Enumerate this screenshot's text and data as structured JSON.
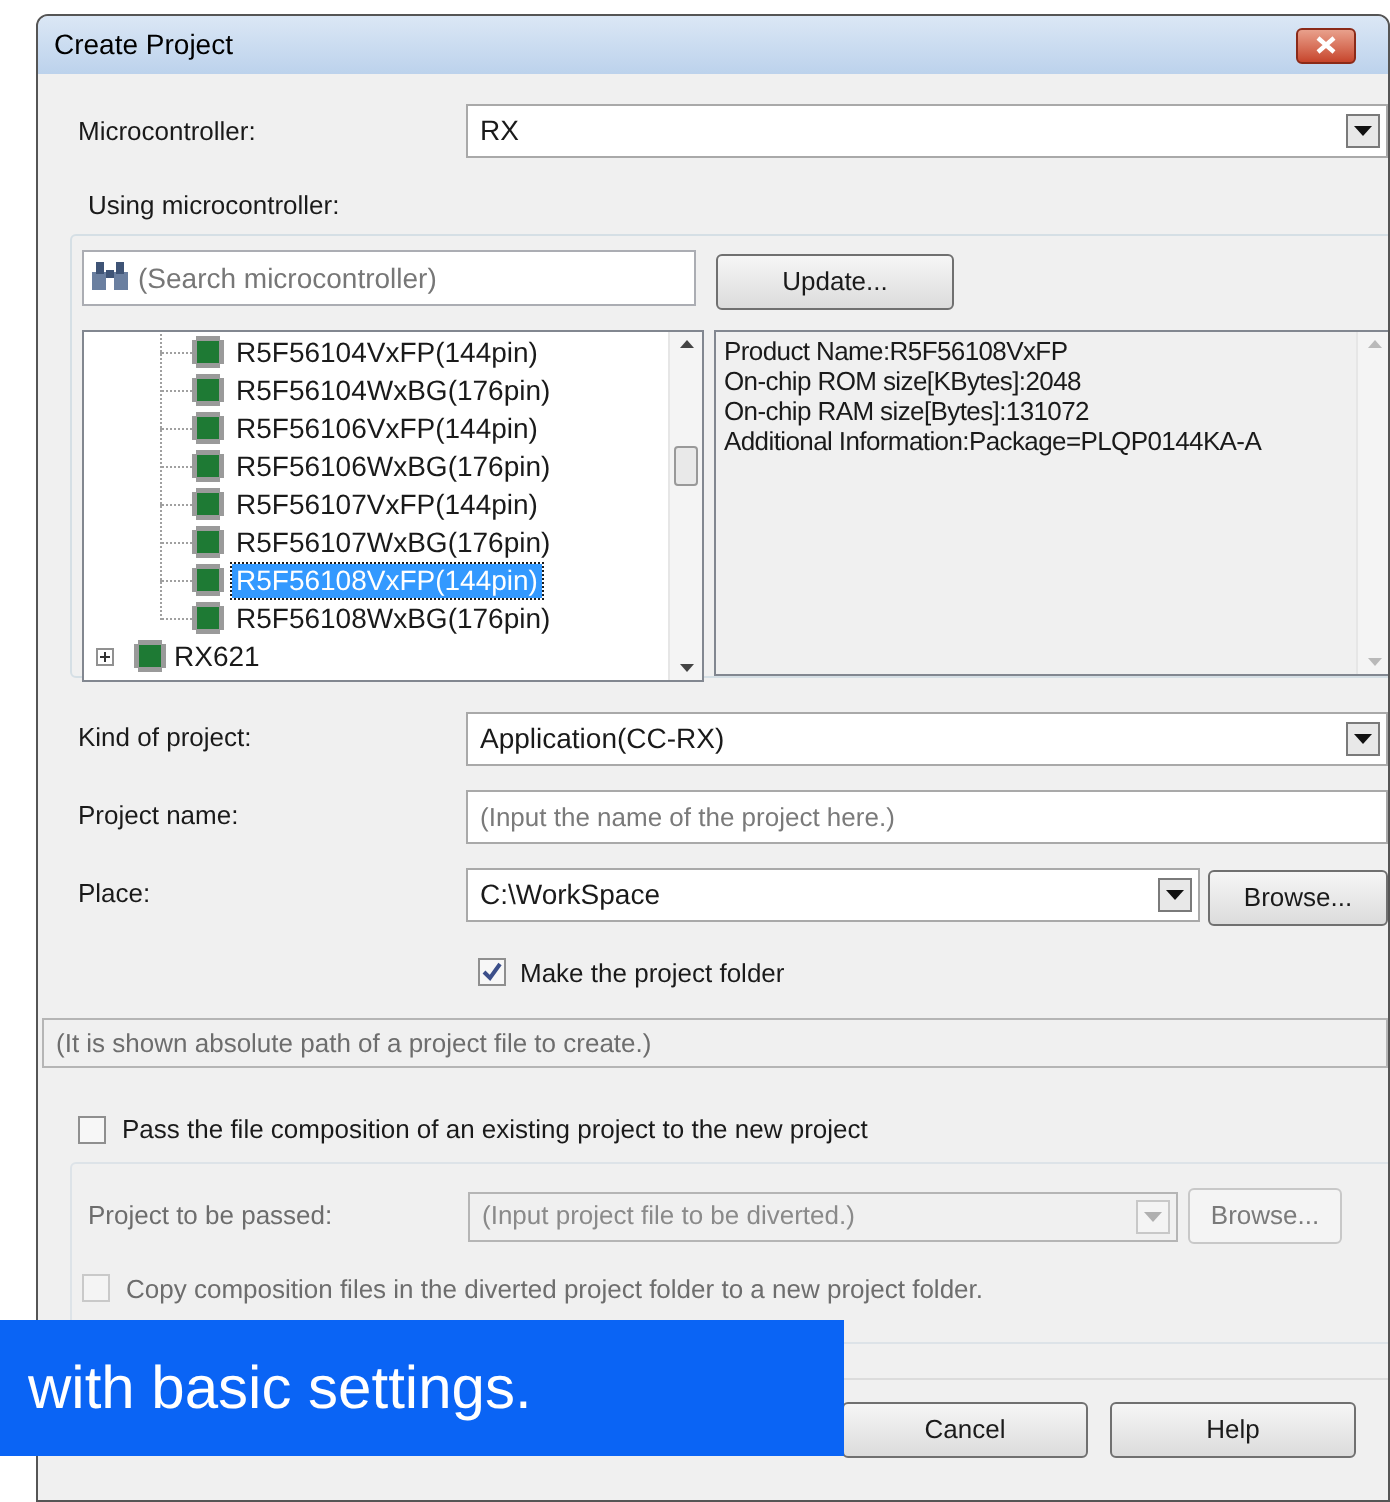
{
  "window": {
    "title": "Create Project"
  },
  "microcontroller": {
    "label": "Microcontroller:",
    "value": "RX"
  },
  "using_label": "Using microcontroller:",
  "search": {
    "placeholder": "(Search microcontroller)"
  },
  "update_button": "Update...",
  "tree": [
    {
      "children": [
        {
          "label": "R5F56104VxFP(144pin)",
          "selected": false
        },
        {
          "label": "R5F56104WxBG(176pin)",
          "selected": false
        },
        {
          "label": "R5F56106VxFP(144pin)",
          "selected": false
        },
        {
          "label": "R5F56106WxBG(176pin)",
          "selected": false
        },
        {
          "label": "R5F56107VxFP(144pin)",
          "selected": false
        },
        {
          "label": "R5F56107WxBG(176pin)",
          "selected": false
        },
        {
          "label": "R5F56108VxFP(144pin)",
          "selected": true
        },
        {
          "label": "R5F56108WxBG(176pin)",
          "selected": false
        }
      ]
    },
    {
      "label": "RX621",
      "expanded": false
    }
  ],
  "details": [
    "Product Name:R5F56108VxFP",
    "On-chip ROM size[KBytes]:2048",
    "On-chip RAM size[Bytes]:131072",
    "Additional Information:Package=PLQP0144KA-A"
  ],
  "fields": [
    {
      "kind": "dropdown",
      "label": "Kind of project:",
      "value": "Application(CC-RX)"
    },
    {
      "kind": "input",
      "label": "Project name:",
      "placeholder": "(Input the name of the project here.)"
    },
    {
      "kind": "combo",
      "label": "Place:",
      "value": "C:\\WorkSpace",
      "button": "Browse..."
    }
  ],
  "make_folder": {
    "label": "Make the project folder",
    "checked": true
  },
  "path_display": {
    "placeholder": "(It is shown absolute path of a project file to create.)"
  },
  "pass_option": {
    "label": "Pass the file composition of an existing project to the new project",
    "checked": false
  },
  "passed": {
    "label": "Project to be passed:",
    "placeholder": "(Input project file to be diverted.)",
    "button": "Browse...",
    "disabled": true
  },
  "copy_option": {
    "label": "Copy composition files in the diverted project folder to a new project folder.",
    "checked": false,
    "disabled": true
  },
  "buttons": [
    "Cancel",
    "Help"
  ],
  "caption": "with basic settings."
}
